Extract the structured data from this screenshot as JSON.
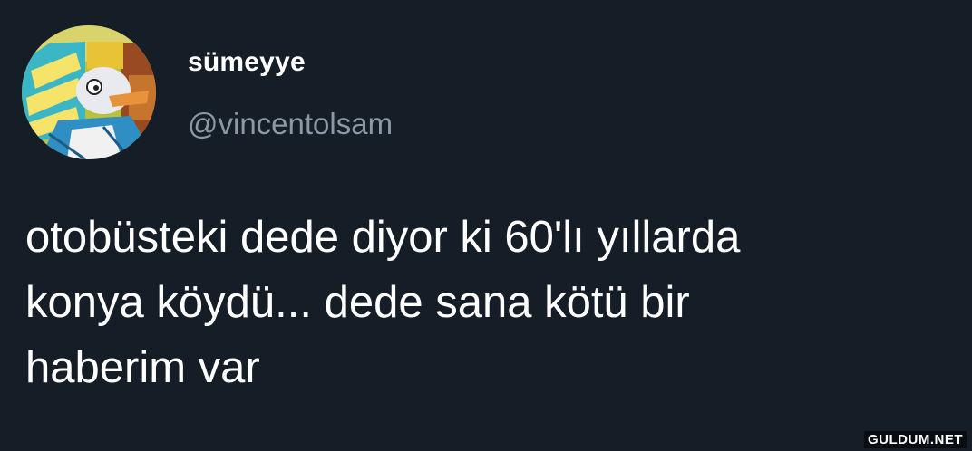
{
  "author": {
    "display_name": "sümeyye",
    "handle": "@vincentolsam",
    "avatar_icon": "cartoon-character-avatar"
  },
  "tweet": {
    "lines": [
      "otobüsteki dede diyor ki 60'lı yıllarda",
      "konya köydü... dede sana kötü bir",
      "haberim var"
    ]
  },
  "watermark": "GULDUM.NET",
  "colors": {
    "background": "#151d27",
    "handle": "#8b98a5",
    "text": "#ffffff"
  }
}
